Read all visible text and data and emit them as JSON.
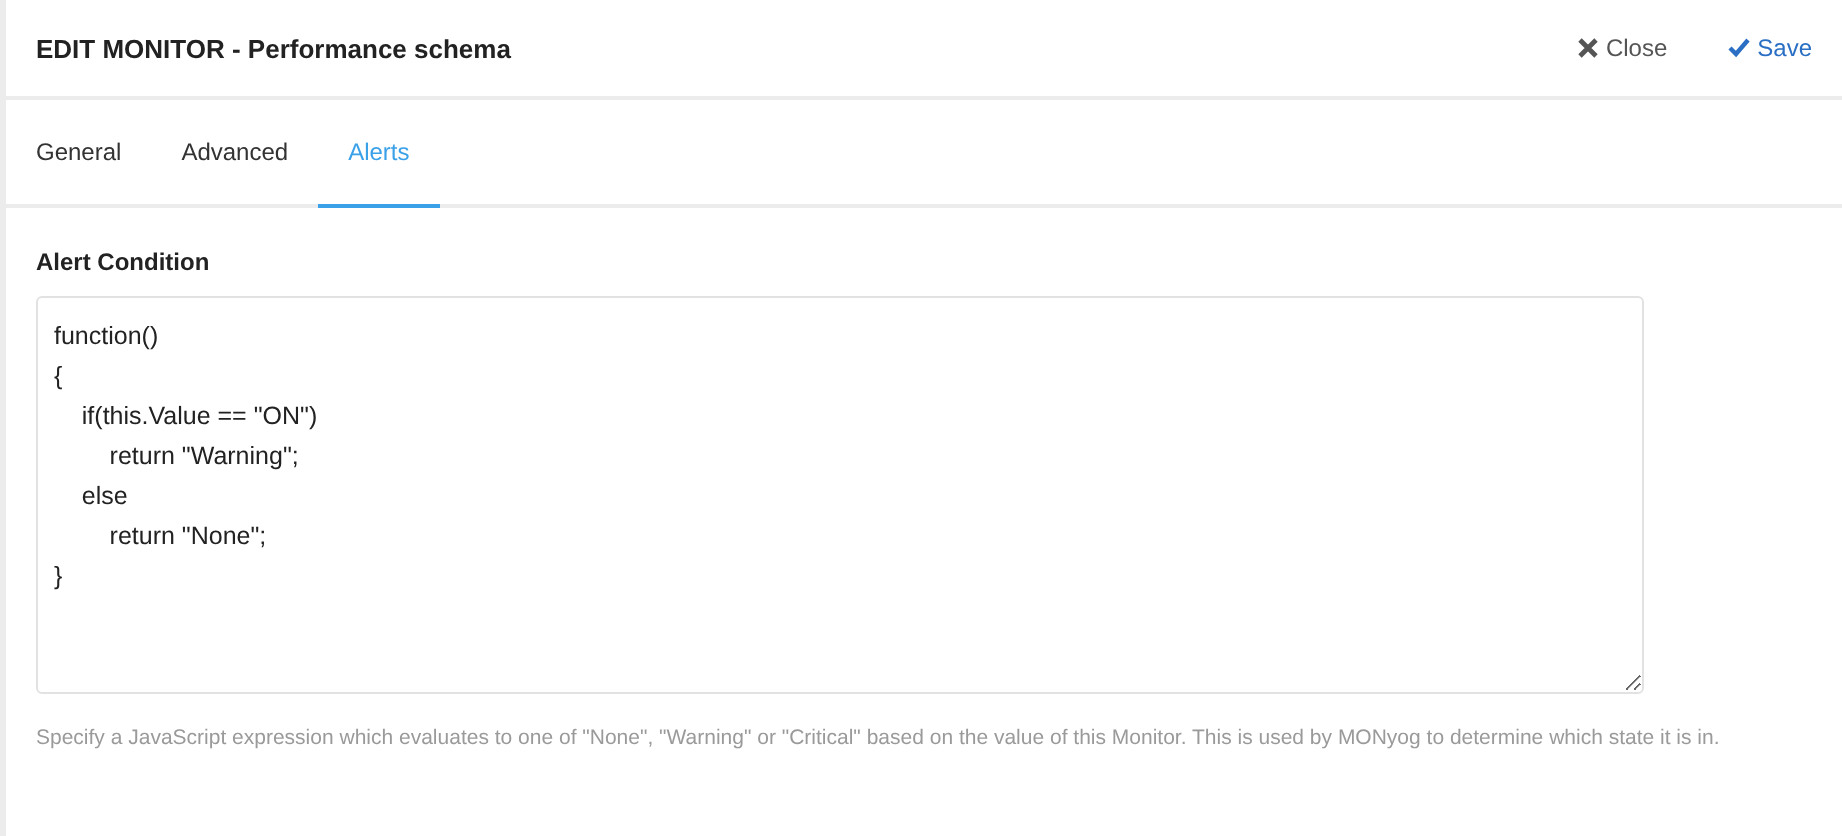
{
  "header": {
    "title": "EDIT MONITOR - Performance schema",
    "actions": [
      {
        "kind": "close",
        "label": "Close"
      },
      {
        "kind": "save",
        "label": "Save"
      }
    ]
  },
  "tabs": [
    {
      "label": "General",
      "selected": false
    },
    {
      "label": "Advanced",
      "selected": false
    },
    {
      "label": "Alerts",
      "selected": true
    }
  ],
  "alert_condition": {
    "label": "Alert Condition",
    "value": "function()\n{\n    if(this.Value == \"ON\")\n        return \"Warning\";\n    else\n        return \"None\";\n}",
    "help": "Specify a JavaScript expression which evaluates to one of \"None\", \"Warning\" or \"Critical\" based on the value of this Monitor. This is used by MONyog to determine which state it is in."
  }
}
